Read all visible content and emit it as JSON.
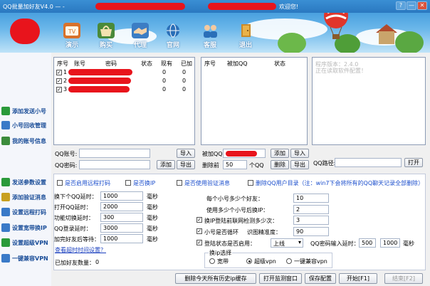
{
  "titlebar": {
    "title": "QQ批量加好友V4.0 — -",
    "welcome": "欢迎您!",
    "btn_help": "?",
    "btn_min": "—",
    "btn_close": "✕"
  },
  "toolbar": [
    {
      "label": "演示",
      "icon": "tv-icon",
      "color": "#d8722a"
    },
    {
      "label": "购买",
      "icon": "basket-icon",
      "color": "#4a8a3a"
    },
    {
      "label": "代理",
      "icon": "handshake-icon",
      "color": "#3c7dc4"
    },
    {
      "label": "官网",
      "icon": "globe-icon",
      "color": "#2a6fb8"
    },
    {
      "label": "客服",
      "icon": "support-icon",
      "color": "#2a6fb8"
    },
    {
      "label": "退出",
      "icon": "door-exit-icon",
      "color": "#c98a2a"
    }
  ],
  "sidebar": [
    {
      "label": "添加发送小号",
      "icon": "add-account-icon",
      "color": "#2a9a3a"
    },
    {
      "label": "小号回收管理",
      "icon": "recycle-icon",
      "color": "#3a7ac8"
    },
    {
      "label": "我的账号信息",
      "icon": "user-info-icon",
      "color": "#3c8c3c"
    },
    {
      "label": "发送参数设置",
      "icon": "settings-icon",
      "color": "#2a9a3a"
    },
    {
      "label": "添加验证消息",
      "icon": "message-icon",
      "color": "#c8a020"
    },
    {
      "label": "设置远程打码",
      "icon": "remote-captcha-icon",
      "color": "#3a7ac8"
    },
    {
      "label": "设置宽带换IP",
      "icon": "network-icon",
      "color": "#3a7ac8"
    },
    {
      "label": "设置超级VPN",
      "icon": "vpn-icon",
      "color": "#2a9a3a"
    },
    {
      "label": "一键兼容VPN",
      "icon": "compat-icon",
      "color": "#3a7ac8"
    }
  ],
  "accounts": {
    "headers": [
      "序号",
      "账号",
      "密码",
      "状态",
      "现有",
      "已加"
    ],
    "rows": [
      {
        "index": "1",
        "checked": "✓",
        "account": "",
        "password": "",
        "status": "",
        "existing": "0",
        "added": "0"
      },
      {
        "index": "2",
        "checked": "✓",
        "account": "",
        "password": "",
        "status": "",
        "existing": "0",
        "added": "0"
      },
      {
        "index": "3",
        "checked": "✓",
        "account": "",
        "password": "",
        "status": "",
        "existing": "0",
        "added": "0"
      }
    ],
    "qq_label": "QQ账号:",
    "pwd_label": "QQ密码:",
    "import_btn": "导入",
    "add_btn": "添加",
    "export_btn": "导出"
  },
  "targets": {
    "headers": [
      "序号",
      "被加QQ",
      "状态"
    ],
    "add_label": "被加QQ:",
    "delete_before_label": "删除前",
    "delete_before_value": "50",
    "unit": "个QQ",
    "add_btn": "添加",
    "import_btn": "导入",
    "delete_btn": "删除",
    "export_btn": "导出"
  },
  "log": {
    "lines": [
      "程序版本：2.4.0",
      "正在读取软件配置！"
    ],
    "path_label": "QQ路径:",
    "open_btn": "打开"
  },
  "settings": {
    "use_remote_captcha": "是否启用远程打码",
    "change_ip": "是否换IP",
    "use_verify_msg": "是否使用验证消息",
    "delete_qq_dir": "删除QQ用户目录（注：win7下会将所有的QQ聊天记录全部删除）",
    "params": [
      {
        "label": "换下个QQ延时：",
        "value": "1000",
        "unit": "毫秒"
      },
      {
        "label": "打开QQ延时：",
        "value": "2000",
        "unit": "毫秒"
      },
      {
        "label": "功能切换延时：",
        "value": "300",
        "unit": "毫秒"
      },
      {
        "label": "QQ登录延时：",
        "value": "3000",
        "unit": "毫秒"
      },
      {
        "label": "加完好友后等待：",
        "value": "1000",
        "unit": "毫秒"
      }
    ],
    "timeout_link": "查看超时时间设置？",
    "added_count_label": "已加好友数量：",
    "added_count_value": "0",
    "per_account_label": "每个小号多少个好友：",
    "per_account_value": "10",
    "switch_ip_label": "使用多少个小号后换IP：",
    "switch_ip_value": "2",
    "detect_label": "换IP登陆前联网检测多少次：",
    "detect_value": "3",
    "loop_label": "小号是否循环",
    "precision_label": "识图精准度：",
    "precision_value": "90",
    "login_state_label": "登陆状态是否启用：",
    "login_state_value": "上线",
    "pwd_delay_label": "QQ密码输入延时：",
    "pwd_delay_min": "500",
    "pwd_delay_max": "1000",
    "pwd_delay_unit": "毫秒",
    "ip_group_label": "换ip选择",
    "ip_options": [
      "宽带",
      "超级vpn",
      "一键兼容vpn"
    ]
  },
  "footer": {
    "delete_history": "删除今天所有历史ip缓存",
    "open_monitor": "打开监测窗口",
    "save_config": "保存配置",
    "start": "开始[F1]",
    "end": "结束[F2]"
  },
  "colors": {
    "accent": "#1a4dcc",
    "redaction": "#e8141c",
    "title_bg": "#2a78c0"
  }
}
